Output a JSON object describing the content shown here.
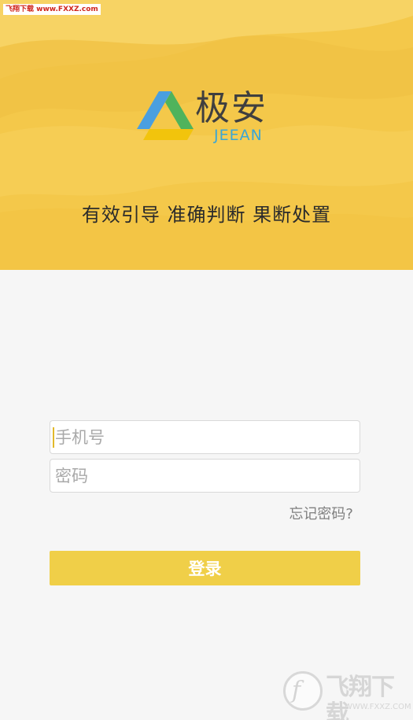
{
  "watermark_top": "飞翔下载 www.FXXZ.com",
  "logo": {
    "cn": "极安",
    "en": "JEEAN"
  },
  "slogan": "有效引导 准确判断 果断处置",
  "form": {
    "phone_placeholder": "手机号",
    "password_placeholder": "密码",
    "forgot_label": "忘记密码?",
    "login_label": "登录"
  },
  "brand_watermark": {
    "text": "飞翔下载",
    "sub": "WWW.FXXZ.COM"
  },
  "colors": {
    "hero_bg": "#f4c84a",
    "button_bg": "#f0cf48",
    "logo_blue": "#3aa6d6",
    "logo_green": "#4fb35c",
    "logo_yellow": "#f2c40c"
  }
}
